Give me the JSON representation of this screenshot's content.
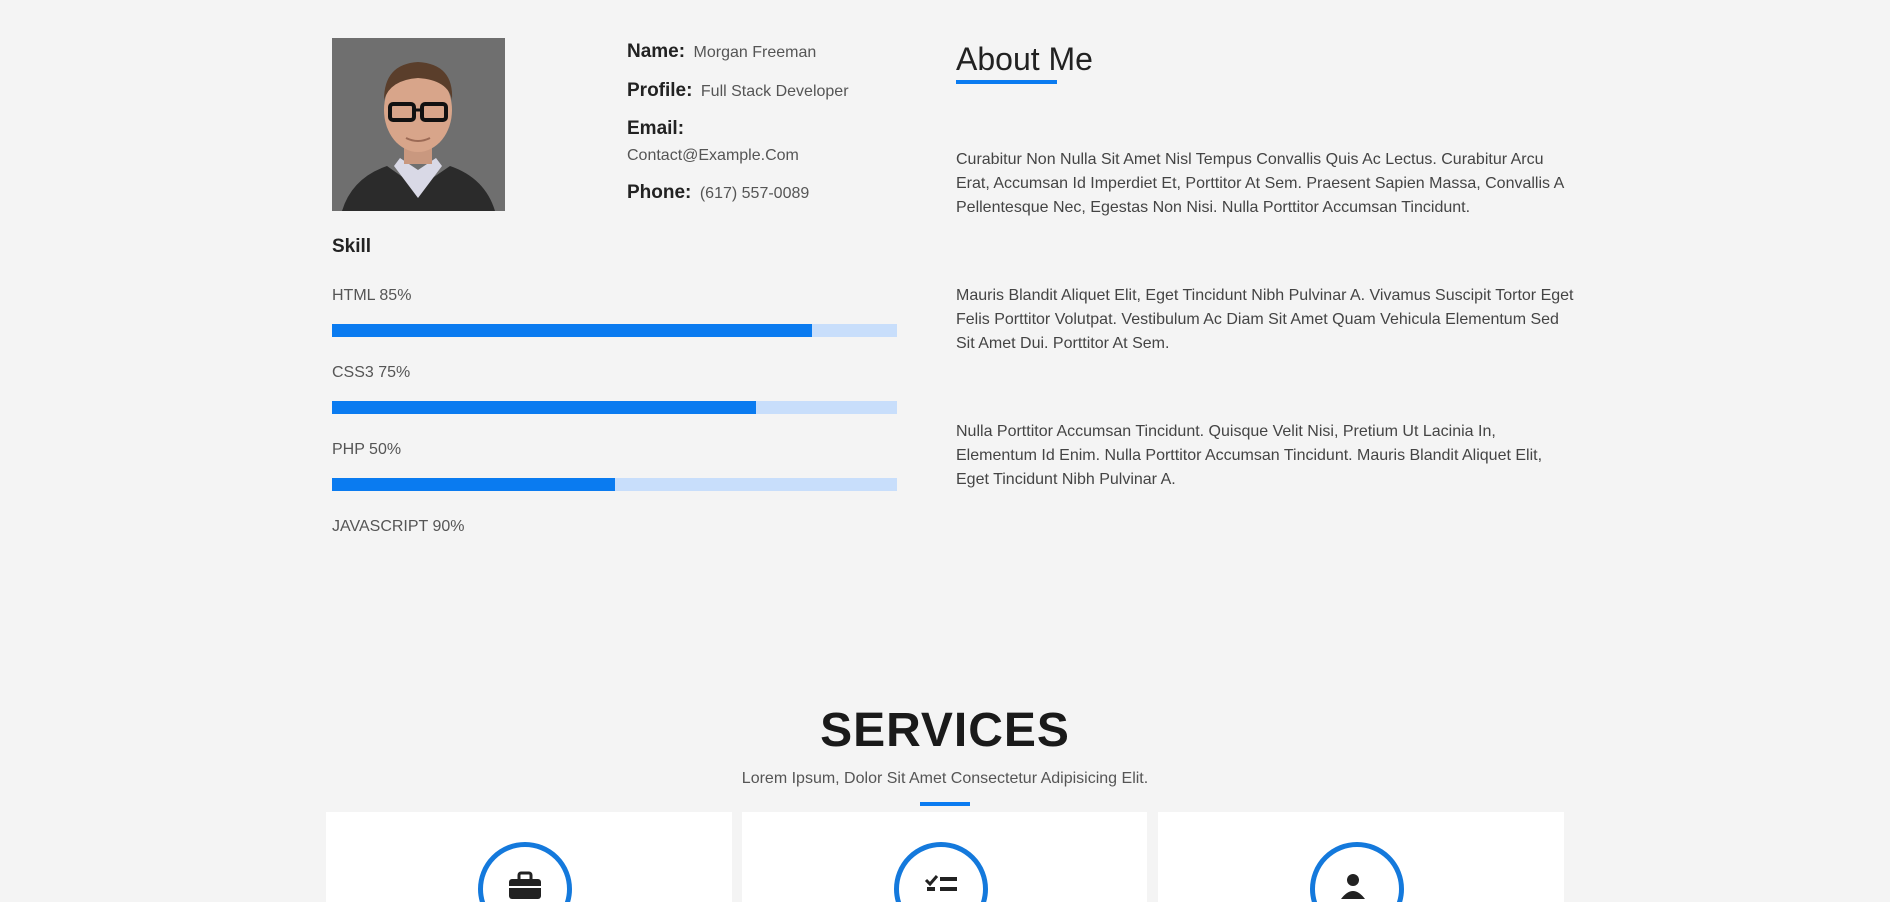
{
  "profile": {
    "photo_alt": "Profile photo",
    "fields": [
      {
        "key": "Name:",
        "value": "Morgan Freeman"
      },
      {
        "key": "Profile:",
        "value": "Full Stack Developer"
      },
      {
        "key": "Email:",
        "value": "Contact@Example.Com"
      },
      {
        "key": "Phone:",
        "value": "(617) 557-0089"
      }
    ]
  },
  "skills": {
    "title": "Skill",
    "items": [
      {
        "label": "HTML 85%",
        "percent": 85
      },
      {
        "label": "CSS3 75%",
        "percent": 75
      },
      {
        "label": "PHP 50%",
        "percent": 50
      },
      {
        "label": "JAVASCRIPT 90%",
        "percent": 90
      }
    ]
  },
  "about": {
    "title": "About Me",
    "paragraphs": [
      "Curabitur Non Nulla Sit Amet Nisl Tempus Convallis Quis Ac Lectus. Curabitur Arcu Erat, Accumsan Id Imperdiet Et, Porttitor At Sem. Praesent Sapien Massa, Convallis A Pellentesque Nec, Egestas Non Nisi. Nulla Porttitor Accumsan Tincidunt.",
      "Mauris Blandit Aliquet Elit, Eget Tincidunt Nibh Pulvinar A. Vivamus Suscipit Tortor Eget Felis Porttitor Volutpat. Vestibulum Ac Diam Sit Amet Quam Vehicula Elementum Sed Sit Amet Dui. Porttitor At Sem.",
      "Nulla Porttitor Accumsan Tincidunt. Quisque Velit Nisi, Pretium Ut Lacinia In, Elementum Id Enim. Nulla Porttitor Accumsan Tincidunt. Mauris Blandit Aliquet Elit, Eget Tincidunt Nibh Pulvinar A."
    ]
  },
  "services": {
    "title": "SERVICES",
    "subtitle": "Lorem Ipsum, Dolor Sit Amet Consectetur Adipisicing Elit.",
    "cards": [
      {
        "icon": "briefcase-icon"
      },
      {
        "icon": "checklist-icon"
      },
      {
        "icon": "user-icon"
      }
    ]
  },
  "colors": {
    "accent": "#0a7bf0",
    "track": "#c8defb",
    "background": "#f4f4f4",
    "card": "#ffffff",
    "icon_ring": "#1479dc"
  }
}
